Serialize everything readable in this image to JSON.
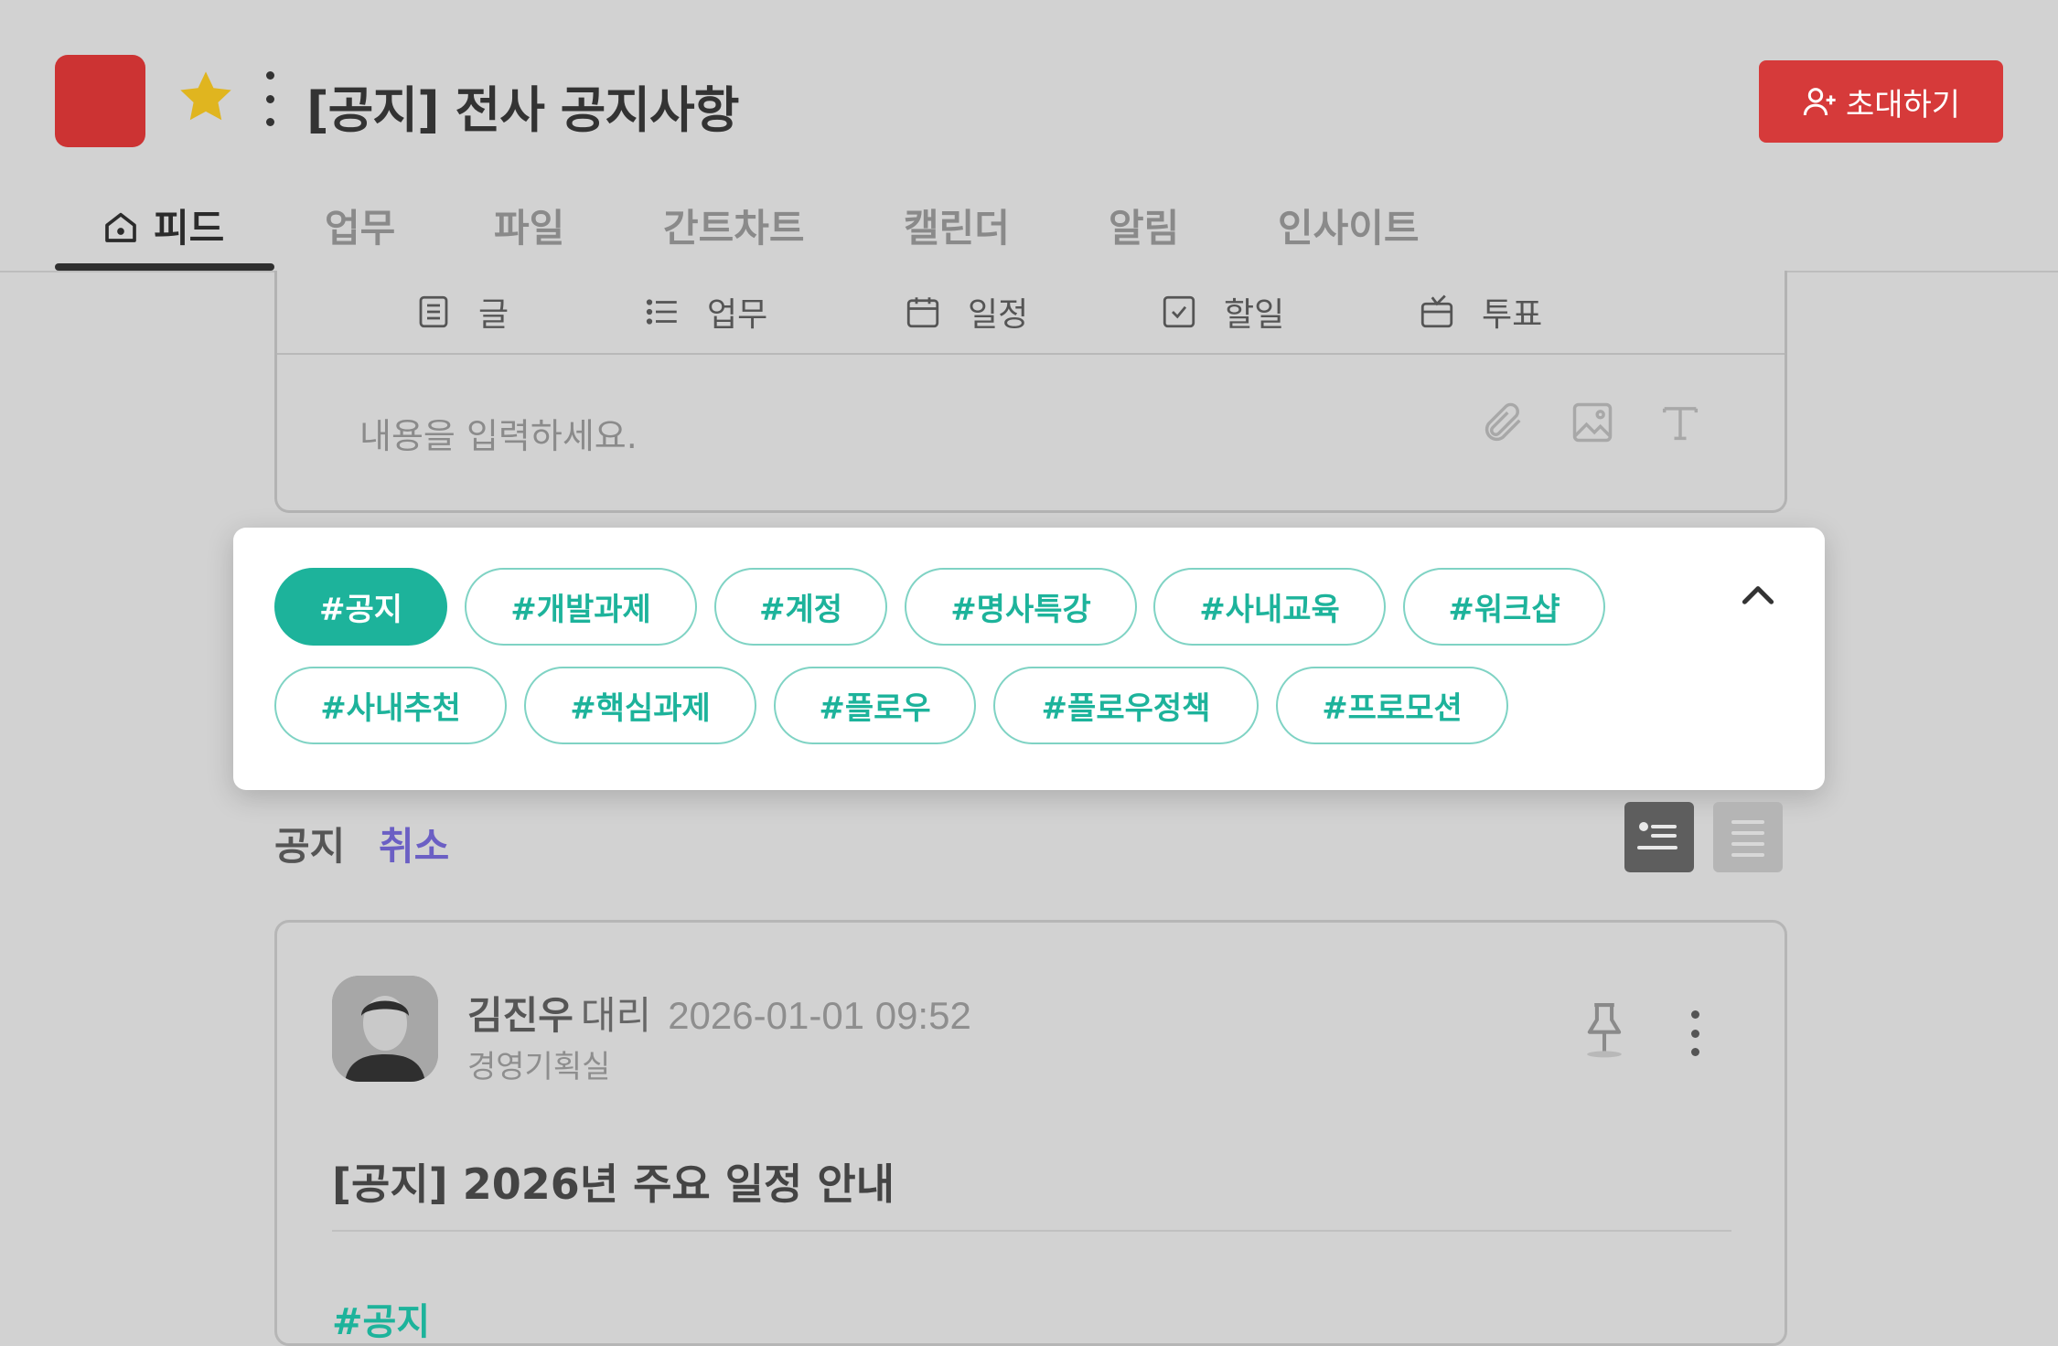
{
  "header": {
    "room_title": "[공지] 전사 공지사항",
    "invite_label": "초대하기",
    "room_color": "#cc3333",
    "star_color": "#e0b51f"
  },
  "tabs": [
    {
      "label": "피드",
      "icon": "home-icon",
      "active": true
    },
    {
      "label": "업무"
    },
    {
      "label": "파일"
    },
    {
      "label": "간트차트"
    },
    {
      "label": "캘린더"
    },
    {
      "label": "알림"
    },
    {
      "label": "인사이트"
    }
  ],
  "composer": {
    "types": [
      {
        "label": "글",
        "icon": "document-icon"
      },
      {
        "label": "업무",
        "icon": "task-list-icon"
      },
      {
        "label": "일정",
        "icon": "calendar-icon"
      },
      {
        "label": "할일",
        "icon": "checkbox-icon"
      },
      {
        "label": "투표",
        "icon": "vote-icon"
      }
    ],
    "placeholder": "내용을 입력하세요.",
    "tools": [
      "attach-icon",
      "image-icon",
      "text-format-icon"
    ]
  },
  "tag_popup": {
    "tags": [
      "#공지",
      "#개발과제",
      "#계정",
      "#명사특강",
      "#사내교육",
      "#워크샵",
      "#사내추천",
      "#핵심과제",
      "#플로우",
      "#플로우정책",
      "#프로모션"
    ],
    "selected": "#공지",
    "accent": "#1db39b"
  },
  "filter": {
    "label": "공지",
    "cancel_label": "취소",
    "cancel_color": "#6b5fc4"
  },
  "post": {
    "author_name": "김진우",
    "author_rank": "대리",
    "timestamp": "2026-01-01 09:52",
    "department": "경영기획실",
    "title": "[공지] 2026년 주요 일정 안내",
    "tag": "#공지"
  }
}
